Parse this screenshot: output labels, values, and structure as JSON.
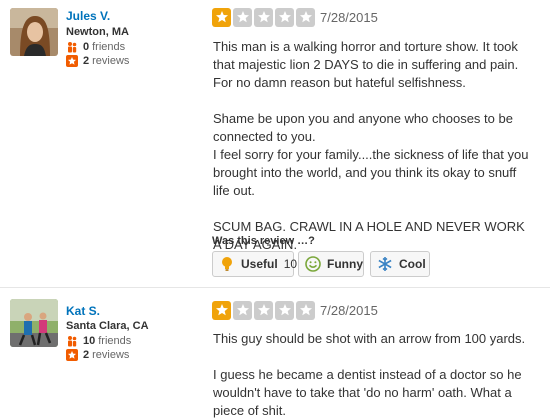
{
  "reviews": [
    {
      "user": {
        "name": "Jules V.",
        "location": "Newton, MA",
        "friends_count": "0",
        "friends_label": "friends",
        "reviews_count": "2",
        "reviews_label": "reviews"
      },
      "rating": 1,
      "date": "7/28/2015",
      "paragraphs": [
        "This man is a walking horror and torture show.  It took that majestic lion 2 DAYS to die in suffering and pain.  For no damn reason but hateful selfishness.",
        "Shame be upon you and anyone who chooses to be connected to you.\nI feel sorry for your family....the sickness of life that you brought into the world, and you think its okay to snuff life out.",
        "SCUM BAG.  CRAWL IN A HOLE AND  NEVER WORK A DAY AGAIN."
      ],
      "was_this_review": "Was this review …?",
      "votes": {
        "useful_label": "Useful",
        "useful_count": "10",
        "funny_label": "Funny",
        "cool_label": "Cool"
      }
    },
    {
      "user": {
        "name": "Kat S.",
        "location": "Santa Clara, CA",
        "friends_count": "10",
        "friends_label": "friends",
        "reviews_count": "2",
        "reviews_label": "reviews"
      },
      "rating": 1,
      "date": "7/28/2015",
      "paragraphs": [
        "This guy should be shot with an arrow from 100 yards.",
        "I guess he became a dentist instead of a doctor so he wouldn't have to take that 'do no harm' oath.  What a piece of shit."
      ]
    }
  ],
  "icons": {
    "friends": "friends-icon",
    "reviews": "review-star-icon",
    "useful": "lightbulb-icon",
    "funny": "smiley-icon",
    "cool": "snowflake-icon",
    "star": "star-icon"
  },
  "colors": {
    "link": "#0073bb",
    "star_on": "#f0a30a",
    "star_off": "#cccccc",
    "reviews_badge": "#f15c00",
    "friends_icon": "#f15c00"
  }
}
